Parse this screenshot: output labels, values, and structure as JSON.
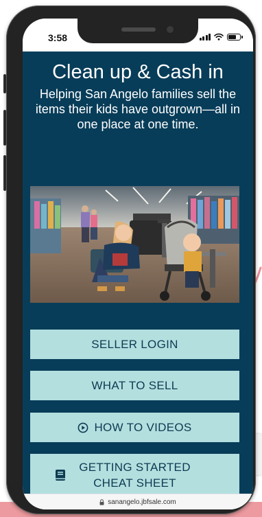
{
  "status_bar": {
    "time": "3:58",
    "battery_level": 0.7
  },
  "page": {
    "title": "Clean up & Cash in",
    "subtitle": "Helping San Angelo families sell the items their kids have outgrown—all in one place at one time."
  },
  "hero_image": {
    "icon": "hero-photo"
  },
  "buttons": {
    "seller_login": "SELLER LOGIN",
    "what_to_sell": "WHAT TO SELL",
    "how_to_videos": "HOW TO VIDEOS",
    "cheat_sheet_line1": "GETTING STARTED",
    "cheat_sheet_line2": "CHEAT SHEET"
  },
  "icons": {
    "how_to_videos": "play-circle-icon",
    "cheat_sheet": "book-icon",
    "address_lock": "lock-icon"
  },
  "browser": {
    "url": "sanangelo.jbfsale.com"
  },
  "colors": {
    "page_background": "#083d59",
    "button_background": "#b4dfdf",
    "button_text": "#0d3b52",
    "accent_pink": "#ec9a9f"
  }
}
